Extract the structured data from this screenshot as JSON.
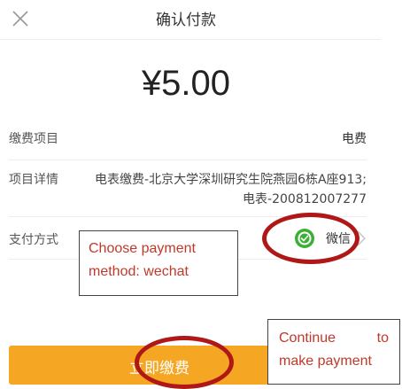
{
  "header": {
    "title": "确认付款",
    "close_icon": "close-icon"
  },
  "amount": "¥5.00",
  "fee_row": {
    "label": "缴费项目",
    "value": "电费"
  },
  "detail_row": {
    "label": "项目详情",
    "value_line1": "电表缴费-北京大学深圳研究生院燕园6栋A座913;",
    "value_line2": "电表-200812007277"
  },
  "payment_row": {
    "label": "支付方式",
    "method": "微信",
    "method_icon": "wechat-icon"
  },
  "pay_button": {
    "label": "立即缴费",
    "color": "#f5a623"
  },
  "annotations": {
    "choose_line1": "Choose payment",
    "choose_line2": "method: wechat",
    "continue_word1": "Continue",
    "continue_word2": "to",
    "continue_line2": "make payment",
    "text_color": "#c0392b",
    "ellipse_color": "#b01818"
  }
}
